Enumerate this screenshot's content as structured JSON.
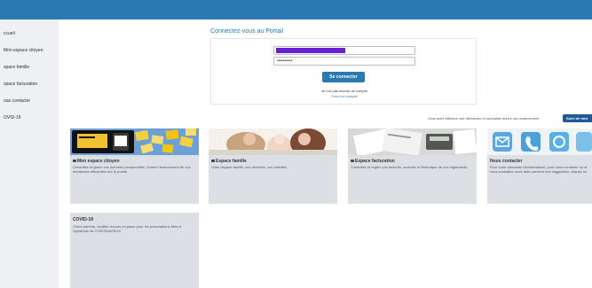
{
  "sidebar": {
    "items": [
      {
        "label": "ccueil"
      },
      {
        "label": "Mon espace citoyen"
      },
      {
        "label": "space famille"
      },
      {
        "label": "space facturation"
      },
      {
        "label": "ous contacter"
      },
      {
        "label": "OVID-19"
      }
    ]
  },
  "login": {
    "title": "Connectez-vous au Portail",
    "username_value": "",
    "password_value": "••••••••••",
    "submit_label": "Se connecter",
    "no_account_text": "Je n'ai pas encore de compte",
    "create_account_link": "Créer un compte"
  },
  "notice": {
    "text": "Vous avez effectué une démarche et souhaitez suivre son avancement",
    "button_label": "Suivi de mes"
  },
  "cards": [
    {
      "title": "Mon espace citoyen",
      "description": "Consultez et gérez vos données personnelles. Suivez l'avancement de vos demandes effectuées sur le portail",
      "icon": "lock-icon"
    },
    {
      "title": "Espace famille",
      "description": "Votre espace famille, vos données, vos activités",
      "icon": "lock-icon"
    },
    {
      "title": "Espace facturation",
      "description": "Consultez et réglez vos factures, accédez à l'historique de vos règlements",
      "icon": "lock-icon"
    },
    {
      "title": "Nous contacter",
      "description": "Pour toute demande d'informations, pour nous contacter ou si vous souhaitez nous faire parvenir une suggestion, cliquez ici",
      "icon": "none"
    },
    {
      "title": "COVID-19",
      "description": "Chers parents, veuillez trouver en place pour les prescriptions liées à l'épidémie de CORONAVIRUS",
      "icon": "none"
    }
  ],
  "colors": {
    "brand": "#2b78b3",
    "card_bg": "#dcdfe4",
    "mask": "#6a1fd0"
  }
}
